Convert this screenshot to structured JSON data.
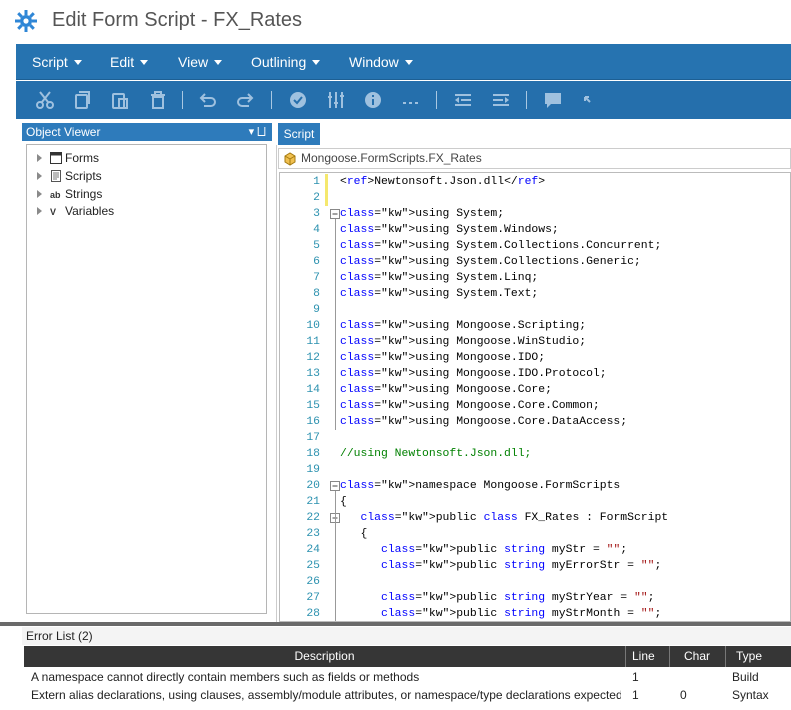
{
  "window": {
    "title": "Edit Form Script - FX_Rates"
  },
  "menu": {
    "items": [
      {
        "label": "Script"
      },
      {
        "label": "Edit"
      },
      {
        "label": "View"
      },
      {
        "label": "Outlining"
      },
      {
        "label": "Window"
      }
    ]
  },
  "toolbar": {
    "icons": [
      "cut-icon",
      "copy-icon",
      "paste-icon",
      "delete-icon",
      "undo-icon",
      "redo-icon",
      "check-icon",
      "settings-sliders-icon",
      "info-icon",
      "ellipsis-icon",
      "outdent-icon",
      "indent-icon",
      "comment-icon",
      "uncomment-icon"
    ]
  },
  "object_viewer": {
    "title": "Object Viewer",
    "controls": "▾ ⨆",
    "items": [
      {
        "label": "Forms",
        "icon": "form-icon"
      },
      {
        "label": "Scripts",
        "icon": "script-icon"
      },
      {
        "label": "Strings",
        "icon": "ab"
      },
      {
        "label": "Variables",
        "icon": "V"
      }
    ]
  },
  "script_tab": {
    "label": "Script",
    "breadcrumb": "Mongoose.FormScripts.FX_Rates"
  },
  "code": {
    "lines": [
      {
        "n": "1",
        "text": "<ref>Newtonsoft.Json.dll</ref>"
      },
      {
        "n": "2",
        "text": ""
      },
      {
        "n": "3",
        "text": "using System;"
      },
      {
        "n": "4",
        "text": "using System.Windows;"
      },
      {
        "n": "5",
        "text": "using System.Collections.Concurrent;"
      },
      {
        "n": "6",
        "text": "using System.Collections.Generic;"
      },
      {
        "n": "7",
        "text": "using System.Linq;"
      },
      {
        "n": "8",
        "text": "using System.Text;"
      },
      {
        "n": "9",
        "text": ""
      },
      {
        "n": "10",
        "text": "using Mongoose.Scripting;"
      },
      {
        "n": "11",
        "text": "using Mongoose.WinStudio;"
      },
      {
        "n": "12",
        "text": "using Mongoose.IDO;"
      },
      {
        "n": "13",
        "text": "using Mongoose.IDO.Protocol;"
      },
      {
        "n": "14",
        "text": "using Mongoose.Core;"
      },
      {
        "n": "15",
        "text": "using Mongoose.Core.Common;"
      },
      {
        "n": "16",
        "text": "using Mongoose.Core.DataAccess;"
      },
      {
        "n": "17",
        "text": ""
      },
      {
        "n": "18",
        "text": "//using Newtonsoft.Json.dll;"
      },
      {
        "n": "19",
        "text": ""
      },
      {
        "n": "20",
        "text": "namespace Mongoose.FormScripts"
      },
      {
        "n": "21",
        "text": "{"
      },
      {
        "n": "22",
        "text": "   public class FX_Rates : FormScript"
      },
      {
        "n": "23",
        "text": "   {"
      },
      {
        "n": "24",
        "text": "      public string myStr = \"\";"
      },
      {
        "n": "25",
        "text": "      public string myErrorStr = \"\";"
      },
      {
        "n": "26",
        "text": ""
      },
      {
        "n": "27",
        "text": "      public string myStrYear = \"\";"
      },
      {
        "n": "28",
        "text": "      public string myStrMonth = \"\";"
      }
    ]
  },
  "error_list": {
    "title": "Error List (2)",
    "columns": [
      "Description",
      "Line",
      "Char",
      "Type"
    ],
    "rows": [
      {
        "description": "A namespace cannot directly contain members such as fields or methods",
        "line": "1",
        "char": "",
        "type": "Build"
      },
      {
        "description": "Extern alias declarations, using clauses, assembly/module attributes, or namespace/type declarations expected",
        "line": "1",
        "char": "0",
        "type": "Syntax"
      }
    ]
  },
  "colors": {
    "accent": "#2673b0",
    "keyword": "#0000ff",
    "comment": "#008000",
    "line_number": "#2b91af"
  }
}
